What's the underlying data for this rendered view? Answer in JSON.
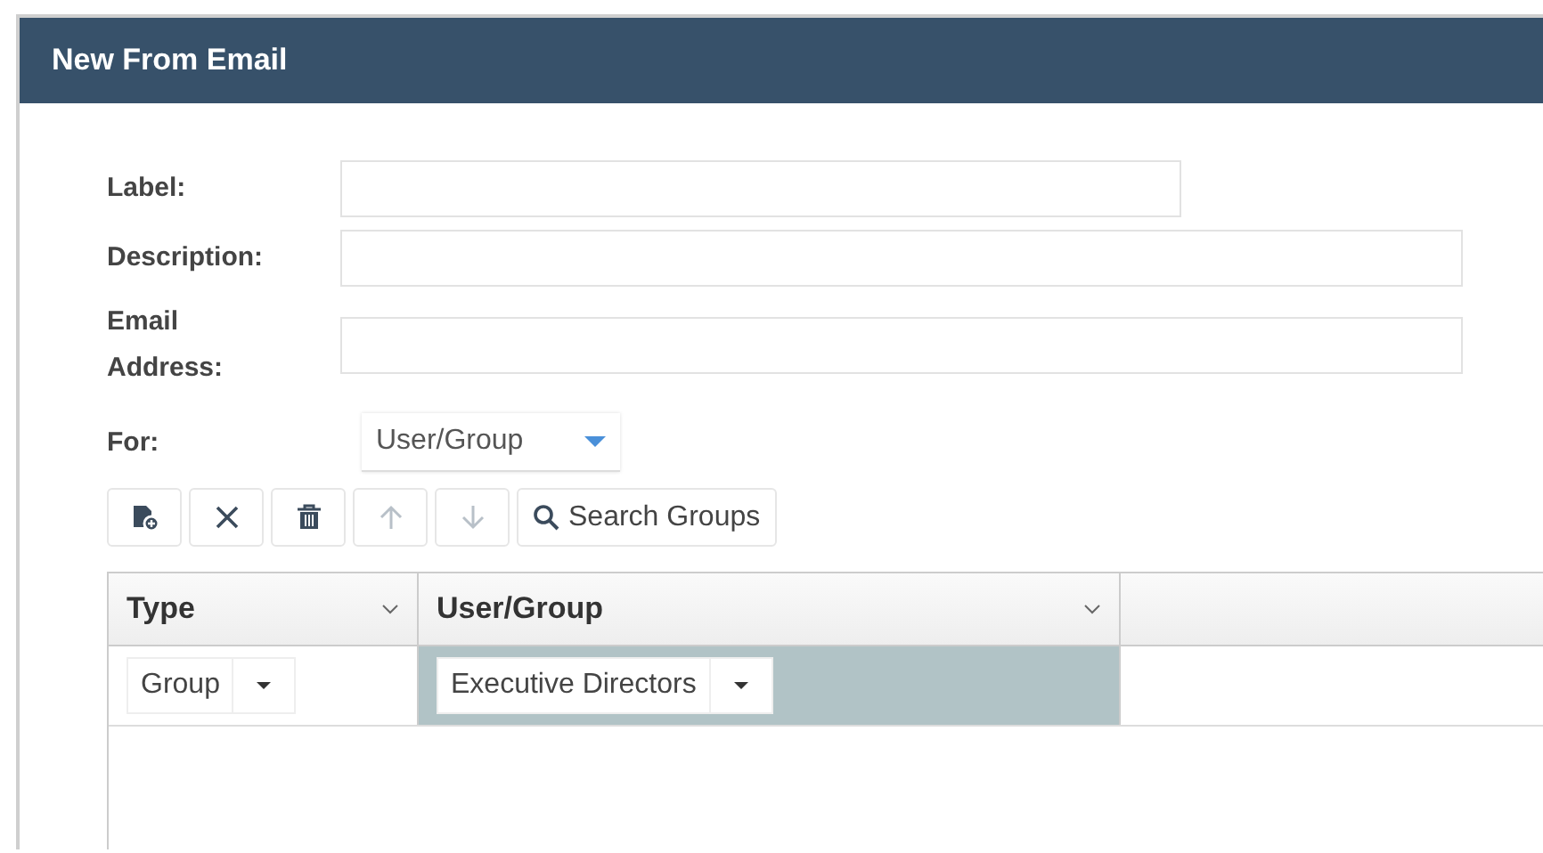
{
  "window": {
    "title": "New From Email"
  },
  "form": {
    "fields": [
      {
        "label": "Label:",
        "kind": "short"
      },
      {
        "label": "Description:",
        "kind": "wide"
      },
      {
        "label": "Email Address:",
        "kind": "wide"
      }
    ],
    "for": {
      "label": "For:",
      "value": "User/Group"
    }
  },
  "toolbar": [
    {
      "kind": "add",
      "disabled": false
    },
    {
      "kind": "clear",
      "disabled": false
    },
    {
      "kind": "delete",
      "disabled": false
    },
    {
      "kind": "up",
      "disabled": true
    },
    {
      "kind": "down",
      "disabled": true
    },
    {
      "kind": "search",
      "label": "Search Groups",
      "disabled": false
    }
  ],
  "table": {
    "columns": [
      "Type",
      "User/Group"
    ],
    "rows": [
      {
        "selected": true,
        "cells": [
          "Group",
          "Executive Directors"
        ]
      }
    ]
  }
}
